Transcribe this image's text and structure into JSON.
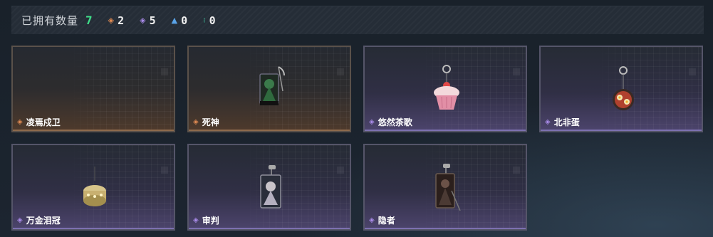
{
  "header": {
    "owned_label": "已拥有数量",
    "owned_count": "7",
    "stats": [
      {
        "icon": "orange-rarity-icon",
        "color": "#e08a52",
        "value": "2"
      },
      {
        "icon": "purple-rarity-icon",
        "color": "#a98be8",
        "value": "5"
      },
      {
        "icon": "blue-rarity-icon",
        "color": "#5aa4e8",
        "value": "0"
      },
      {
        "icon": "green-rarity-icon",
        "color": "#3fc4a0",
        "value": "0"
      }
    ]
  },
  "items": [
    {
      "name": "凌焉戍卫",
      "rarity": "orange",
      "icon": "empty-slot"
    },
    {
      "name": "死神",
      "rarity": "orange",
      "icon": "reaper-tag-icon"
    },
    {
      "name": "悠然茶歌",
      "rarity": "purple",
      "icon": "cupcake-charm-icon"
    },
    {
      "name": "北非蛋",
      "rarity": "purple",
      "icon": "shakshuka-pan-charm-icon"
    },
    {
      "name": "万金泪冠",
      "rarity": "purple",
      "icon": "golden-crown-charm-icon"
    },
    {
      "name": "审判",
      "rarity": "purple",
      "icon": "judgment-tag-icon"
    },
    {
      "name": "隐者",
      "rarity": "purple",
      "icon": "hermit-tag-icon"
    }
  ]
}
